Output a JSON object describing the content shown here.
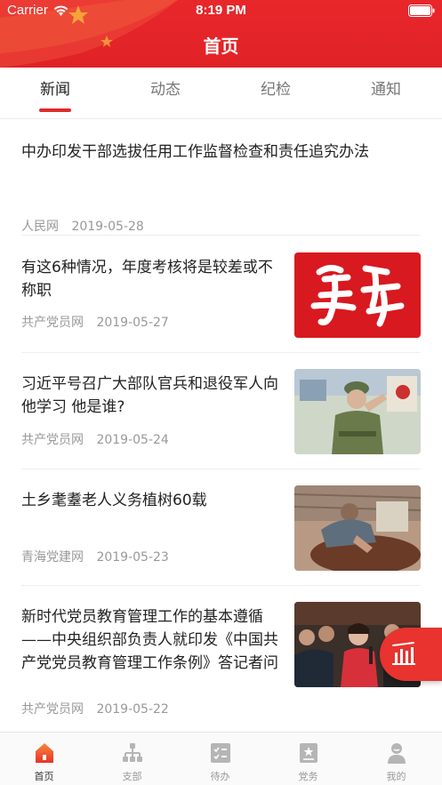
{
  "status_bar": {
    "carrier": "Carrier",
    "time": "8:19 PM"
  },
  "header": {
    "title": "首页",
    "accent_color": "#e02226"
  },
  "tabs": [
    {
      "label": "新闻",
      "active": true
    },
    {
      "label": "动态",
      "active": false
    },
    {
      "label": "纪检",
      "active": false
    },
    {
      "label": "通知",
      "active": false
    }
  ],
  "news": [
    {
      "title": "中办印发干部选拔任用工作监督检查和责任追究办法",
      "source": "人民网",
      "date": "2019-05-28",
      "image": "none"
    },
    {
      "title": "有这6种情况，年度考核将是较差或不称职",
      "source": "共产党员网",
      "date": "2019-05-27",
      "image": "xuexi-calligraphy"
    },
    {
      "title": "习近平号召广大部队官兵和退役军人向他学习 他是谁?",
      "source": "共产党员网",
      "date": "2019-05-24",
      "image": "veteran-saluting"
    },
    {
      "title": "土乡耄耋老人义务植树60载",
      "source": "青海党建网",
      "date": "2019-05-23",
      "image": "elder-with-seeds"
    },
    {
      "title": "新时代党员教育管理工作的基本遵循 ——中央组织部负责人就印发《中国共产党党员教育管理工作条例》答记者问",
      "source": "共产党员网",
      "date": "2019-05-22",
      "image": "press-conference"
    }
  ],
  "bottom_nav": [
    {
      "label": "首页",
      "icon": "home-icon",
      "active": true
    },
    {
      "label": "支部",
      "icon": "org-chart-icon",
      "active": false
    },
    {
      "label": "待办",
      "icon": "todo-list-icon",
      "active": false
    },
    {
      "label": "党务",
      "icon": "party-book-icon",
      "active": false
    },
    {
      "label": "我的",
      "icon": "profile-icon",
      "active": false
    }
  ],
  "floating_button": {
    "icon": "chart-bars-icon"
  }
}
